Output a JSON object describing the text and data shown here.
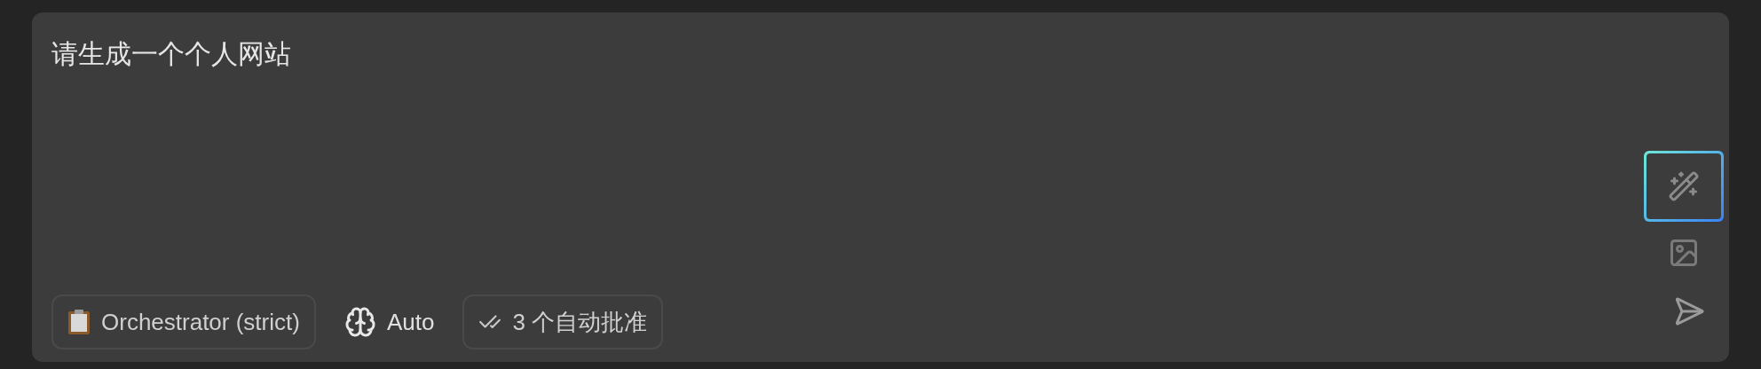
{
  "prompt": {
    "value": "请生成一个个人网站"
  },
  "toolbar": [
    {
      "kind": "mode",
      "label": "Orchestrator (strict)"
    },
    {
      "kind": "model",
      "label": "Auto"
    },
    {
      "kind": "approvals",
      "label": "3 个自动批准"
    }
  ],
  "side_buttons": [
    {
      "kind": "enhance",
      "highlighted": true
    },
    {
      "kind": "image",
      "highlighted": false
    },
    {
      "kind": "send",
      "highlighted": false
    }
  ]
}
